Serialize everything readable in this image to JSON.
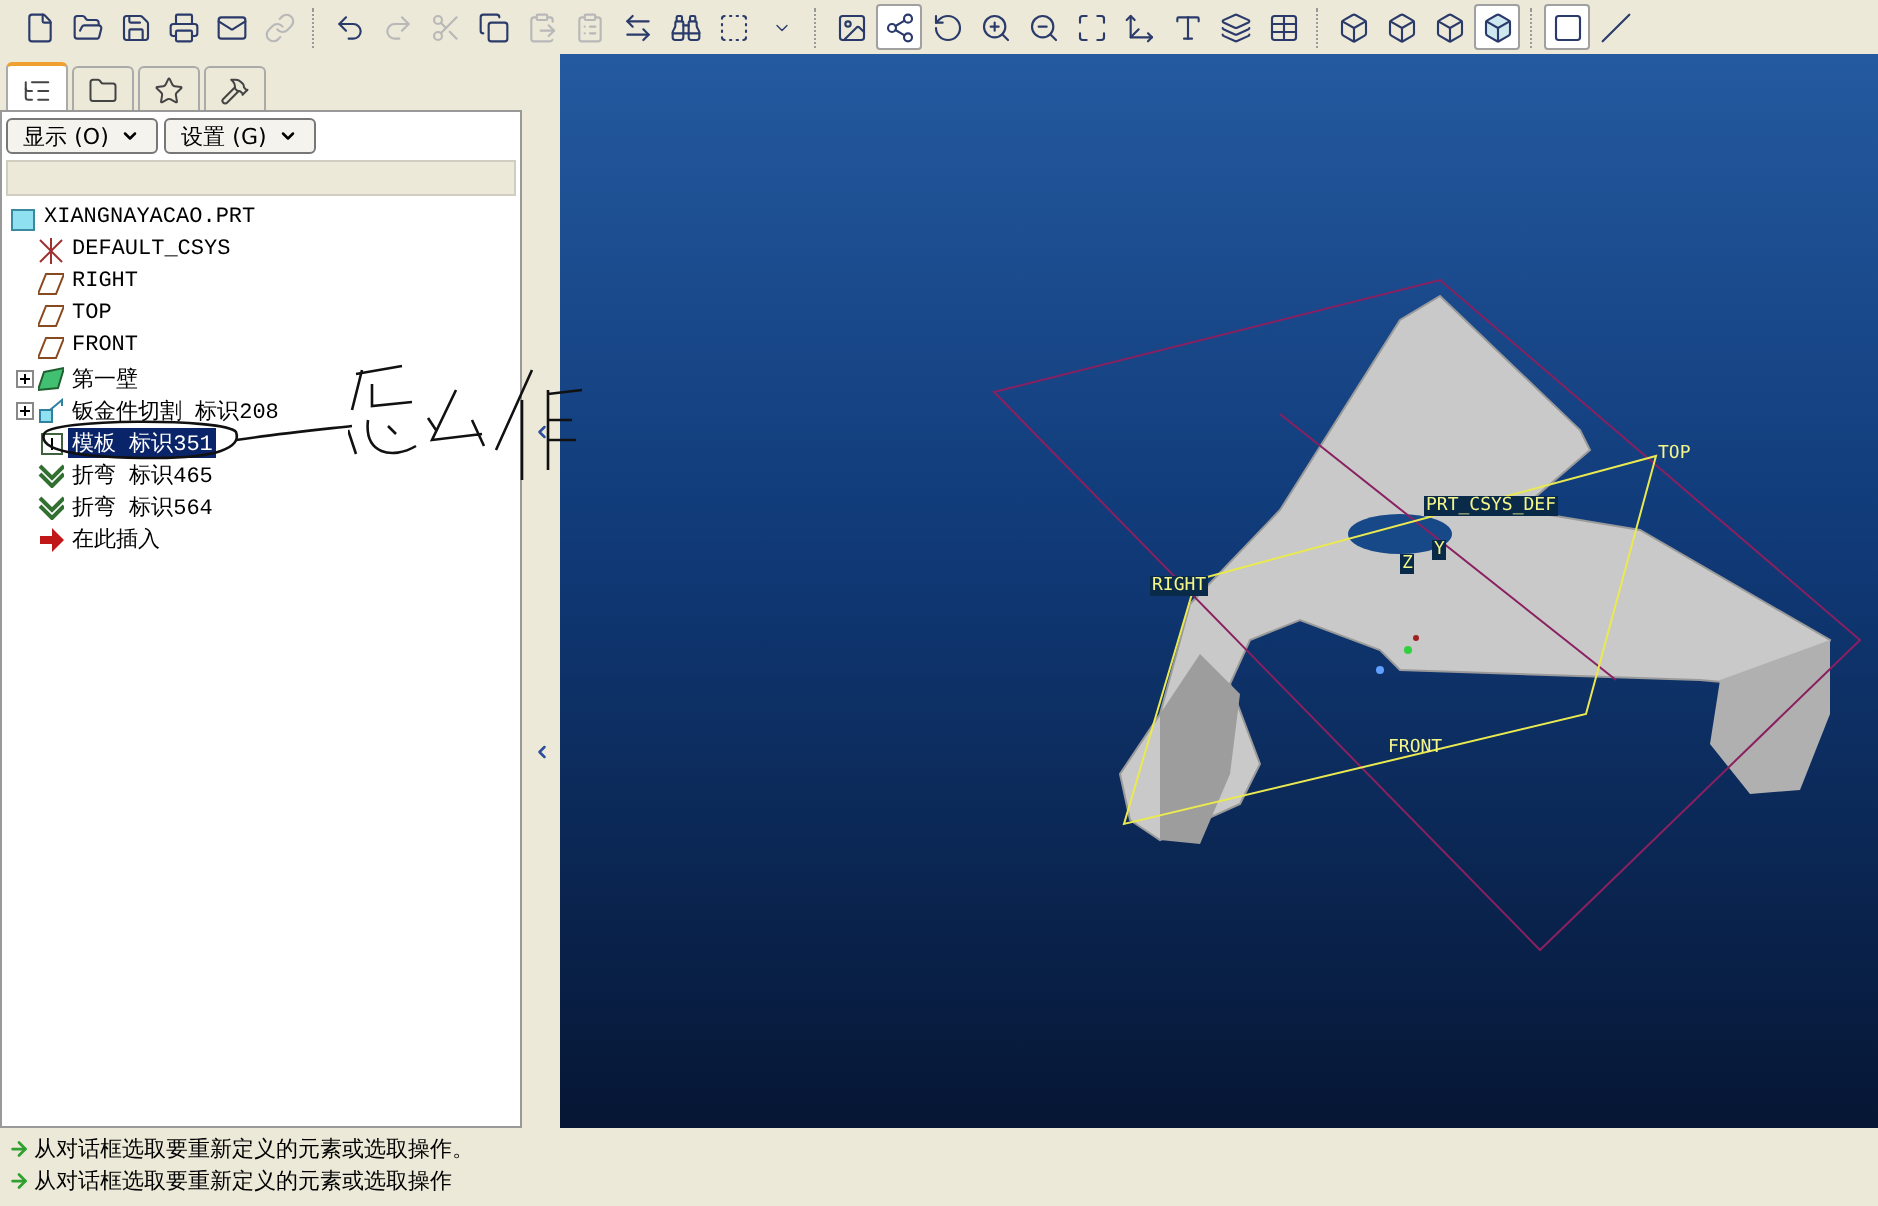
{
  "toolbar": [
    {
      "kind": "new",
      "disabled": false,
      "pressed": false
    },
    {
      "kind": "open",
      "disabled": false,
      "pressed": false
    },
    {
      "kind": "save",
      "disabled": false,
      "pressed": false
    },
    {
      "kind": "print",
      "disabled": false,
      "pressed": false
    },
    {
      "kind": "mail",
      "disabled": false,
      "pressed": false
    },
    {
      "kind": "link",
      "disabled": true,
      "pressed": false
    },
    {
      "kind": "sep"
    },
    {
      "kind": "undo",
      "disabled": false,
      "pressed": false
    },
    {
      "kind": "redo",
      "disabled": true,
      "pressed": false
    },
    {
      "kind": "cut",
      "disabled": true,
      "pressed": false
    },
    {
      "kind": "copy",
      "disabled": false,
      "pressed": false
    },
    {
      "kind": "paste",
      "disabled": true,
      "pressed": false
    },
    {
      "kind": "paste-special",
      "disabled": true,
      "pressed": false
    },
    {
      "kind": "regenerate",
      "disabled": false,
      "pressed": false
    },
    {
      "kind": "find",
      "disabled": false,
      "pressed": false
    },
    {
      "kind": "select-box",
      "disabled": false,
      "pressed": false
    },
    {
      "kind": "dropdown",
      "disabled": false,
      "pressed": false
    },
    {
      "kind": "sep"
    },
    {
      "kind": "repaint",
      "disabled": false,
      "pressed": false
    },
    {
      "kind": "spin-center",
      "disabled": false,
      "pressed": true
    },
    {
      "kind": "orient",
      "disabled": false,
      "pressed": false
    },
    {
      "kind": "zoom-in",
      "disabled": false,
      "pressed": false
    },
    {
      "kind": "zoom-out",
      "disabled": false,
      "pressed": false
    },
    {
      "kind": "refit",
      "disabled": false,
      "pressed": false
    },
    {
      "kind": "reorient",
      "disabled": false,
      "pressed": false
    },
    {
      "kind": "view-list",
      "disabled": false,
      "pressed": false
    },
    {
      "kind": "layers",
      "disabled": false,
      "pressed": false
    },
    {
      "kind": "view-manager",
      "disabled": false,
      "pressed": false
    },
    {
      "kind": "sep"
    },
    {
      "kind": "wireframe",
      "disabled": false,
      "pressed": false
    },
    {
      "kind": "hidden-line",
      "disabled": false,
      "pressed": false
    },
    {
      "kind": "no-hidden",
      "disabled": false,
      "pressed": false
    },
    {
      "kind": "shading",
      "disabled": false,
      "pressed": true
    },
    {
      "kind": "sep"
    },
    {
      "kind": "datum-plane",
      "disabled": false,
      "pressed": true
    },
    {
      "kind": "datum-axis",
      "disabled": false,
      "pressed": false
    }
  ],
  "panel_tabs": [
    {
      "kind": "model-tree",
      "selected": true
    },
    {
      "kind": "folder",
      "selected": false
    },
    {
      "kind": "favorites",
      "selected": false
    },
    {
      "kind": "tools",
      "selected": false
    }
  ],
  "panel_buttons": [
    {
      "label": "显示 (O)"
    },
    {
      "label": "设置 (G)"
    }
  ],
  "tree": {
    "label": "XIANGNAYACAO.PRT",
    "children": [
      {
        "label": "DEFAULT_CSYS",
        "kind": "csys",
        "expandable": false,
        "selected": false
      },
      {
        "label": "RIGHT",
        "kind": "plane",
        "expandable": false,
        "selected": false
      },
      {
        "label": "TOP",
        "kind": "plane",
        "expandable": false,
        "selected": false
      },
      {
        "label": "FRONT",
        "kind": "plane",
        "expandable": false,
        "selected": false
      },
      {
        "label": "第一壁",
        "kind": "wall",
        "expandable": true,
        "selected": false
      },
      {
        "label": "钣金件切割 标识208",
        "kind": "cut",
        "expandable": true,
        "selected": false
      },
      {
        "label": "模板 标识351",
        "kind": "form",
        "expandable": false,
        "selected": true
      },
      {
        "label": "折弯 标识465",
        "kind": "bend",
        "expandable": false,
        "selected": false
      },
      {
        "label": "折弯 标识564",
        "kind": "bend",
        "expandable": false,
        "selected": false
      },
      {
        "label": "在此插入",
        "kind": "insert",
        "expandable": false,
        "selected": false
      }
    ]
  },
  "viewport": {
    "labels": [
      {
        "text": "TOP",
        "boxed": false
      },
      {
        "text": "PRT_CSYS_DEF",
        "boxed": true
      },
      {
        "text": "Z",
        "boxed": true
      },
      {
        "text": "Y",
        "boxed": true
      },
      {
        "text": "RIGHT",
        "boxed": true
      },
      {
        "text": "FRONT",
        "boxed": false
      }
    ]
  },
  "status_bar": {
    "messages": [
      "从对话框选取要重新定义的元素或选取操作。",
      "从对话框选取要重新定义的元素或选取操作"
    ]
  }
}
